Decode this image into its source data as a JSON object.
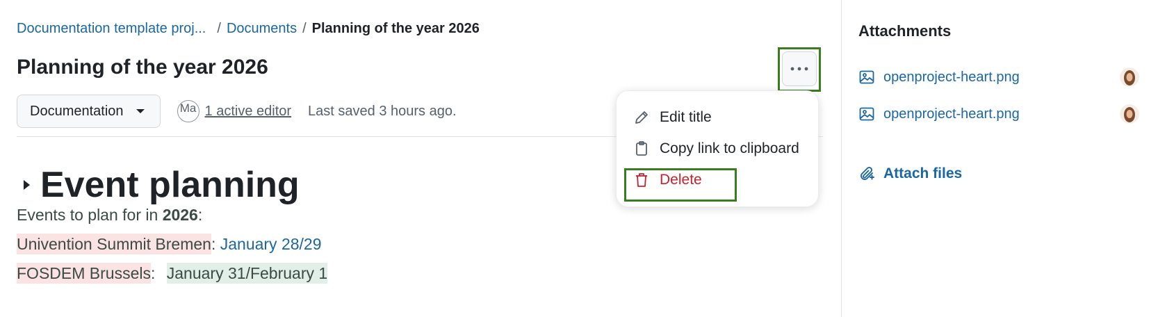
{
  "breadcrumb": {
    "items": [
      "Documentation template proj...",
      "Documents"
    ],
    "separator": "/",
    "current": "Planning of the year 2026"
  },
  "page": {
    "title": "Planning of the year 2026"
  },
  "toolbar": {
    "type_select": "Documentation",
    "avatar_initials": "Ma",
    "active_editors": "1 active editor",
    "last_saved": "Last saved 3 hours ago."
  },
  "document": {
    "heading": "Event planning",
    "intro_prefix": "Events to plan for in ",
    "intro_year": "2026",
    "intro_suffix": ":",
    "lines": [
      {
        "name": "Univention Summit Bremen",
        "sep": ": ",
        "date": "January 28/29"
      },
      {
        "name": "FOSDEM Brussels",
        "sep": ": ",
        "date": "January 31/February 1"
      }
    ]
  },
  "menu": {
    "items": [
      {
        "label": "Edit title",
        "icon": "pencil-icon"
      },
      {
        "label": "Copy link to clipboard",
        "icon": "clipboard-icon"
      },
      {
        "label": "Delete",
        "icon": "trash-icon"
      }
    ]
  },
  "attachments": {
    "title": "Attachments",
    "files": [
      {
        "name": "openproject-heart.png",
        "icon": "image-icon"
      },
      {
        "name": "openproject-heart.png",
        "icon": "image-icon"
      }
    ],
    "attach_label": "Attach files"
  },
  "colors": {
    "link": "#1a67a3",
    "danger": "#c9202e",
    "highlight_frame": "#3a7d1f",
    "highlight_red": "#fbe3e4",
    "highlight_green": "#e1efe8"
  }
}
